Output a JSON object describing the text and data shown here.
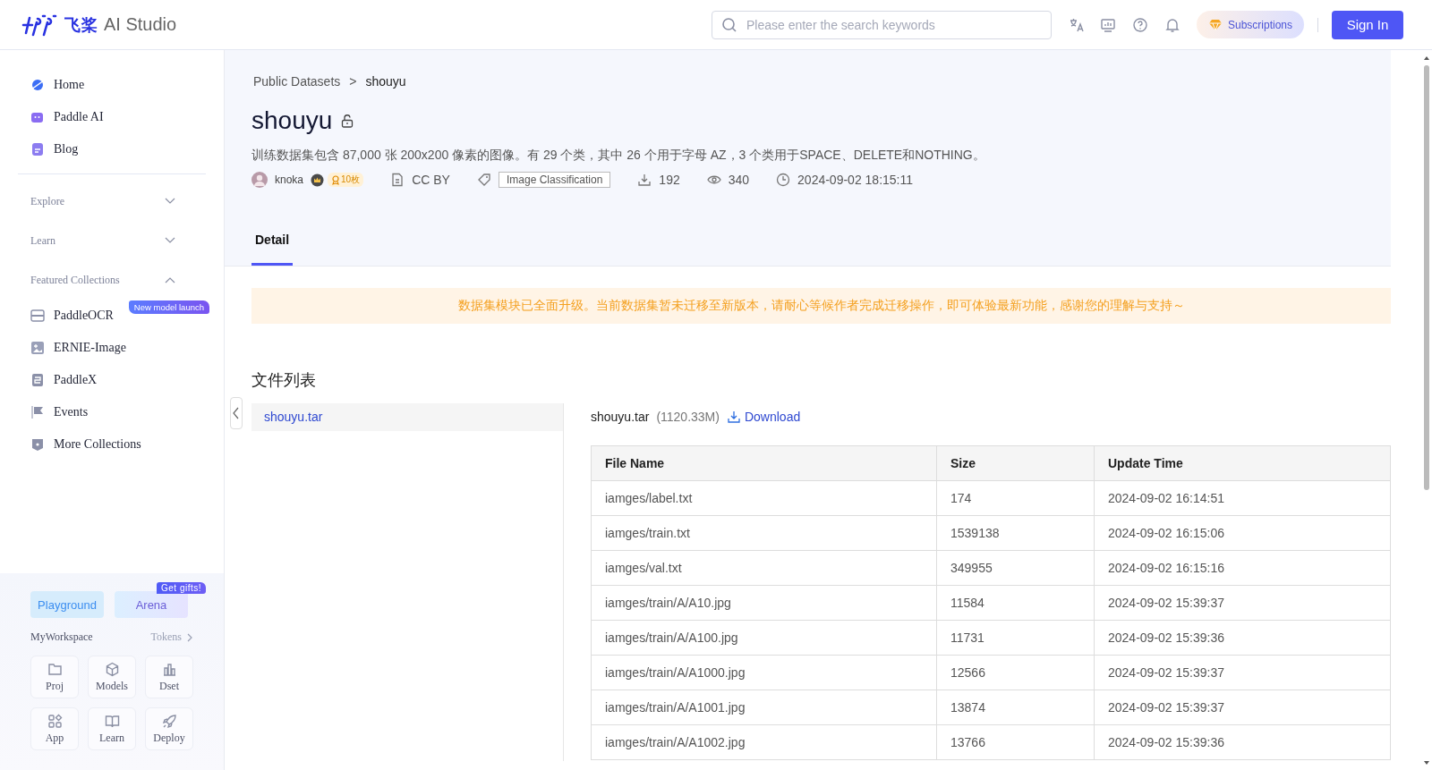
{
  "header": {
    "logo": {
      "brand": "飞桨",
      "product": "AI Studio"
    },
    "search": {
      "placeholder": "Please enter the search keywords"
    },
    "subscriptions": "Subscriptions",
    "sign_in": "Sign In"
  },
  "sidebar": {
    "items": [
      {
        "label": "Home"
      },
      {
        "label": "Paddle AI"
      },
      {
        "label": "Blog"
      }
    ],
    "sections": [
      {
        "label": "Explore",
        "expanded": false
      },
      {
        "label": "Learn",
        "expanded": false
      },
      {
        "label": "Featured Collections",
        "expanded": true,
        "items": [
          {
            "label": "PaddleOCR",
            "badge": "New model launch"
          },
          {
            "label": "ERNIE-Image"
          },
          {
            "label": "PaddleX"
          },
          {
            "label": "Events"
          },
          {
            "label": "More Collections"
          }
        ]
      }
    ],
    "promo": [
      {
        "label": "Playground"
      },
      {
        "label": "Arena",
        "badge": "Get gifts!"
      }
    ],
    "workspace": {
      "title": "MyWorkspace",
      "link": "Tokens",
      "tiles": [
        {
          "label": "Proj"
        },
        {
          "label": "Models"
        },
        {
          "label": "Dset"
        },
        {
          "label": "App"
        },
        {
          "label": "Learn"
        },
        {
          "label": "Deploy"
        }
      ]
    }
  },
  "breadcrumb": {
    "items": [
      "Public Datasets",
      "shouyu"
    ],
    "separator": ">"
  },
  "dataset": {
    "title": "shouyu",
    "description": "训练数据集包含 87,000 张 200x200 像素的图像。有 29 个类，其中 26 个用于字母 AZ，3 个类用于SPACE、DELETE和NOTHING。",
    "author": "knoka",
    "author_badge": "10枚",
    "license": "CC BY",
    "tag": "Image Classification",
    "downloads": "192",
    "views": "340",
    "updated": "2024-09-02 18:15:11"
  },
  "tabs": [
    {
      "label": "Detail",
      "selected": true
    }
  ],
  "notice": "数据集模块已全面升级。当前数据集暂未迁移至新版本，请耐心等候作者完成迁移操作，即可体验最新功能，感谢您的理解与支持～",
  "files_heading": "文件列表",
  "files": [
    {
      "name": "shouyu.tar",
      "selected": true
    }
  ],
  "file_detail": {
    "name": "shouyu.tar",
    "size": "(1120.33M)",
    "download": "Download"
  },
  "table": {
    "columns": [
      "File Name",
      "Size",
      "Update Time"
    ],
    "rows": [
      [
        "iamges/label.txt",
        "174",
        "2024-09-02 16:14:51"
      ],
      [
        "iamges/train.txt",
        "1539138",
        "2024-09-02 16:15:06"
      ],
      [
        "iamges/val.txt",
        "349955",
        "2024-09-02 16:15:16"
      ],
      [
        "iamges/train/A/A10.jpg",
        "11584",
        "2024-09-02 15:39:37"
      ],
      [
        "iamges/train/A/A100.jpg",
        "11731",
        "2024-09-02 15:39:36"
      ],
      [
        "iamges/train/A/A1000.jpg",
        "12566",
        "2024-09-02 15:39:37"
      ],
      [
        "iamges/train/A/A1001.jpg",
        "13874",
        "2024-09-02 15:39:37"
      ],
      [
        "iamges/train/A/A1002.jpg",
        "13766",
        "2024-09-02 15:39:36"
      ]
    ]
  }
}
